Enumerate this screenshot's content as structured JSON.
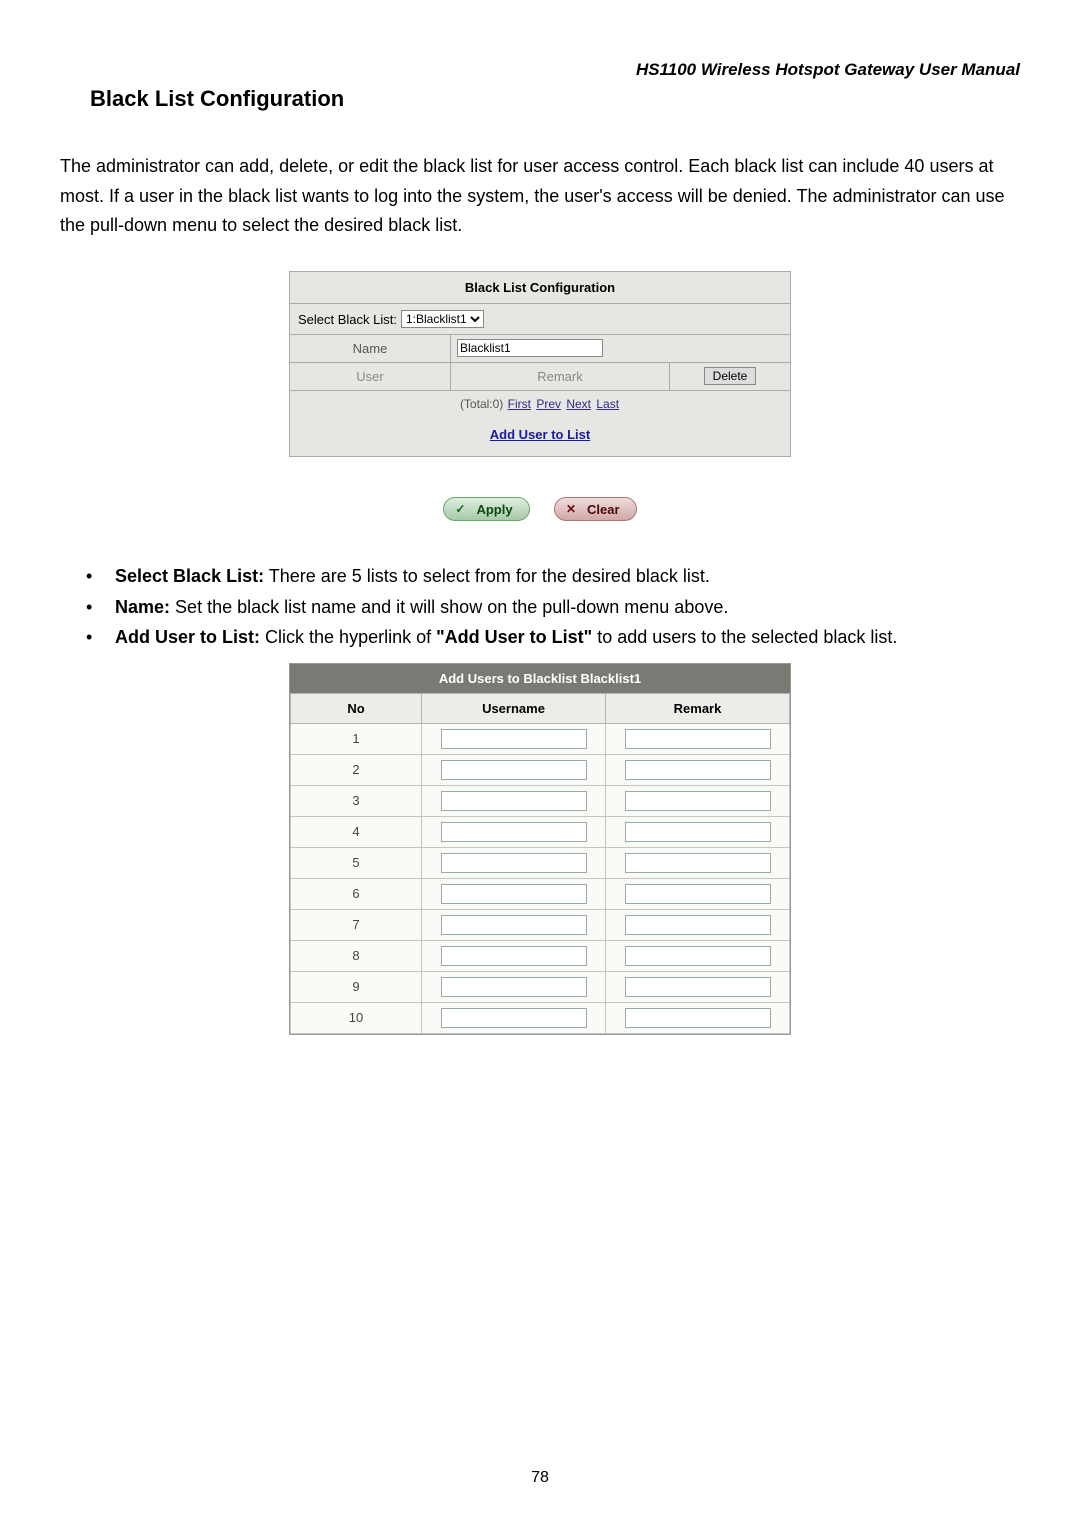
{
  "header": "HS1100 Wireless Hotspot Gateway User Manual",
  "section_title": "Black List Configuration",
  "intro": "The administrator can add, delete, or edit the black list for user access control. Each black list can include 40 users at most. If a user in the black list wants to log into the system, the user's access will be denied. The administrator can use the pull-down menu to select the desired black list.",
  "panel1": {
    "title": "Black List Configuration",
    "select_label": "Select Black List:",
    "select_value": "1:Blacklist1",
    "name_label": "Name",
    "name_value": "Blacklist1",
    "col_user": "User",
    "col_remark": "Remark",
    "delete_btn": "Delete",
    "pager_total": "(Total:0)",
    "pager_first": "First",
    "pager_prev": "Prev",
    "pager_next": "Next",
    "pager_last": "Last",
    "add_link": "Add User to List",
    "apply_btn": "Apply",
    "clear_btn": "Clear"
  },
  "bullets": {
    "b1_strong": "Select Black List:",
    "b1_rest": " There are 5 lists to select from for the desired black list.",
    "b2_strong": "Name:",
    "b2_rest": " Set the black list name and it will show on the pull-down menu above.",
    "b3_strong": "Add User to List:",
    "b3_mid1": " Click the hyperlink of ",
    "b3_quote": "\"Add User to List\"",
    "b3_mid2": " to add users to the selected black list."
  },
  "panel2": {
    "title": "Add Users to Blacklist Blacklist1",
    "col_no": "No",
    "col_username": "Username",
    "col_remark": "Remark",
    "rows": [
      "1",
      "2",
      "3",
      "4",
      "5",
      "6",
      "7",
      "8",
      "9",
      "10"
    ]
  },
  "page_number": "78"
}
